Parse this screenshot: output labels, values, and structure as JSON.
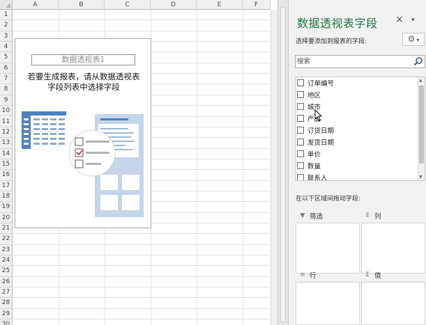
{
  "sheet": {
    "columns": [
      "A",
      "B",
      "C",
      "D",
      "E",
      "F"
    ],
    "rows": [
      "1",
      "2",
      "3",
      "4",
      "5",
      "6",
      "7",
      "8",
      "9",
      "10",
      "11",
      "12",
      "13",
      "14",
      "15",
      "16",
      "17",
      "18",
      "19",
      "20",
      "21",
      "22",
      "23",
      "24",
      "25",
      "26",
      "27",
      "28",
      "29",
      "30"
    ]
  },
  "pivot_placeholder": {
    "name": "数据透视表1",
    "message_line1": "若要生成报表，请从数据透视表",
    "message_line2": "字段列表中选择字段"
  },
  "field_pane": {
    "title": "数据透视表字段",
    "close_glyph": "×",
    "caret_glyph": "▾",
    "choose_label": "选择要添加到报表的字段:",
    "settings_icon": "gear-icon",
    "search_placeholder": "搜索",
    "fields": [
      "订单编号",
      "地区",
      "城市",
      "产品",
      "订货日期",
      "发货日期",
      "单价",
      "数量",
      "联系人"
    ],
    "drag_label": "在以下区域间拖动字段:",
    "areas": {
      "filter": "筛选",
      "columns": "列",
      "rows": "行",
      "values": "值"
    }
  },
  "colors": {
    "accent_green": "#217346",
    "illustration_blue": "#4f81bd",
    "illustration_light": "#c5d6ea",
    "check_red": "#c0504d"
  }
}
